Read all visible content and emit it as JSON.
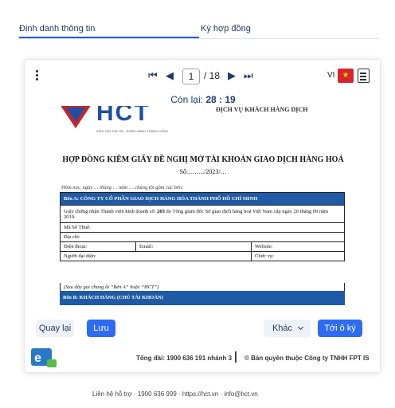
{
  "tabs": [
    {
      "label": "Định danh thông tin"
    },
    {
      "label": "Ký hợp đồng"
    }
  ],
  "viewer": {
    "page_current": "1",
    "page_total": "/ 18",
    "language": "VI",
    "flag": "★",
    "timer_label": "Còn lại:",
    "timer_value": "28 : 19"
  },
  "document": {
    "logo_text": "HCT",
    "logo_sub": "KIẾN TẠO GIÁ TRỊ - ĐỒNG HÀNH THÀNH CÔNG",
    "header_right": "ĐỊCH VỤ KHÁCH HÀNG DỊCH",
    "title": "HỢP ĐỒNG KIÊM GIẤY ĐỀ NGHỊ MỞ TÀI KHOẢN GIAO DỊCH HÀNG HOÁ",
    "number": "Số:……../2023/…",
    "intro": "Hôm nay, ngày … tháng … năm … chúng tôi gồm các bên:",
    "party_a_band": "Bên A: CÔNG TY CỔ PHẦN GIAO DỊCH HÀNG HÓA THÀNH PHỐ HỒ CHÍ MINH",
    "license_prefix": "Giấy chứng nhận Thành viên kinh doanh số: ",
    "license_number": "203",
    "license_suffix": " do Tổng giám đốc Sở giao dịch hàng hoá Việt Nam cấp ngày 20 tháng 09 năm 2019.",
    "tax_code": "Mã Số Thuế:",
    "address": "Địa chỉ:",
    "phone": "Điện thoại:",
    "email": "Email:",
    "website": "Website:",
    "representative": "Người đại diện:",
    "position": "Chức vụ:",
    "note": "(Sau đây gọi chung là “Bên A” hoặc “HCT”)",
    "party_b_band": "Bên B: KHÁCH HÀNG (CHỦ TÀI KHOẢN)"
  },
  "actions": {
    "back": "Quay lại",
    "save": "Lưu",
    "more": "Khác",
    "next": "Tới ô ký"
  },
  "footer": {
    "brand": "e",
    "hotline": "Tổng đài: 1900 636 191 nhánh 3",
    "copyright": "© Bản quyền thuộc Công ty TNHH FPT IS"
  },
  "page_footer": "Liên hệ hỗ trợ  ·  1900 636 999  ·  https://hct.vn  ·  info@hct.vn"
}
